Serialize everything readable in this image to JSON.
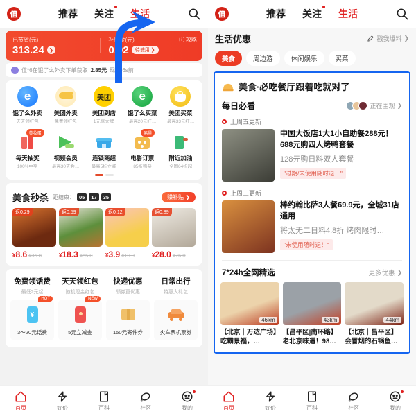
{
  "left": {
    "topbar": {
      "logo_text": "值",
      "tabs": [
        {
          "label": "推荐",
          "active": false,
          "dot": false
        },
        {
          "label": "关注",
          "active": false,
          "dot": true
        },
        {
          "label": "生活",
          "active": true,
          "dot": false
        }
      ],
      "search_icon": "search-icon"
    },
    "banner": {
      "saved_label": "已节省(元)",
      "saved_value": "313.24",
      "subsidy_label": "补贴金(元)",
      "subsidy_value": "0.92",
      "subsidy_pill": "待使用 ❯",
      "guide_label": "攻略",
      "arrow_chevron": "❯"
    },
    "ticker": {
      "prefix": "值*6在饿了么外卖下单获取",
      "amount": "2.85元",
      "suffix": "现金,6s前"
    },
    "grid_row1": [
      {
        "name": "饿了么外卖",
        "sub": "天天领红包",
        "icon": "eleme-icon",
        "color": "#2395ff",
        "tag": ""
      },
      {
        "name": "美团外卖",
        "sub": "免费领红包",
        "icon": "meituan-waimai-icon",
        "color": "#ffd24d",
        "tag": ""
      },
      {
        "name": "美团到店",
        "sub": "1元享大牌",
        "icon": "meituan-icon",
        "color": "#ffcc00",
        "tag": ""
      },
      {
        "name": "饿了么买菜",
        "sub": "最高20元红…",
        "icon": "eleme-green-icon",
        "color": "#27b34a",
        "tag": ""
      },
      {
        "name": "美团买菜",
        "sub": "最高33元红…",
        "icon": "basket-icon",
        "color": "#f5c518",
        "tag": ""
      }
    ],
    "grid_row2": [
      {
        "name": "每天抽奖",
        "sub": "100%中奖",
        "icon": "gift-icon",
        "color": "#f05a5a",
        "tag": "美妆蛋"
      },
      {
        "name": "视频会员",
        "sub": "最高30天会…",
        "icon": "video-play-icon",
        "color": "#5cc85c",
        "tag": ""
      },
      {
        "name": "连锁商超",
        "sub": "最高5折立减",
        "icon": "store-icon",
        "color": "#4db6f0",
        "tag": ""
      },
      {
        "name": "电影订票",
        "sub": "85折购票",
        "icon": "film-icon",
        "color": "#f5b53c",
        "tag": "易量"
      },
      {
        "name": "附近加油",
        "sub": "全国64折起",
        "icon": "fuel-icon",
        "color": "#3cb878",
        "tag": ""
      }
    ],
    "seckill": {
      "title": "美食秒杀",
      "countdown_label": "距结束：",
      "countdown": [
        "05",
        "17",
        "35"
      ],
      "button": "赚补贴 ❯",
      "items": [
        {
          "badge": "返0.29",
          "price": "8.6",
          "old": "¥35.8",
          "thumb": "burger-thumb",
          "c1": "#c0521f",
          "c2": "#7a2d12"
        },
        {
          "badge": "返0.59",
          "price": "18.3",
          "old": "¥55.0",
          "thumb": "skewer-thumb",
          "c1": "#4f8d3a",
          "c2": "#c2782e"
        },
        {
          "badge": "返0.12",
          "price": "3.9",
          "old": "¥10.0",
          "thumb": "dessert-thumb",
          "c1": "#f4c84b",
          "c2": "#f7a9a0"
        },
        {
          "badge": "返0.89",
          "price": "28.0",
          "old": "¥76.0",
          "thumb": "bowl-thumb",
          "c1": "#ddd7cd",
          "c2": "#a8a094"
        }
      ]
    },
    "quad": [
      {
        "title": "免费领话费",
        "sub": "最低2元起",
        "tag": "HOT",
        "label": "3～20元话费",
        "icon": "phone-card-icon",
        "color": "#5bc8f5"
      },
      {
        "title": "天天领红包",
        "sub": "随机现金红包",
        "tag": "NEW",
        "label": "5元立减金",
        "icon": "redpacket-icon",
        "color": "#ef5350"
      },
      {
        "title": "快递优惠",
        "sub": "领券更优惠",
        "tag": "",
        "label": "150元寄件券",
        "icon": "parcel-icon",
        "color": "#f0c069"
      },
      {
        "title": "日常出行",
        "sub": "特惠大礼包",
        "tag": "",
        "label": "火车票机票券",
        "icon": "car-icon",
        "color": "#f08a3c"
      }
    ],
    "tabbar": [
      {
        "label": "首页",
        "icon": "home-icon",
        "active": true,
        "dot": false
      },
      {
        "label": "好价",
        "icon": "tag-icon",
        "active": false,
        "dot": false
      },
      {
        "label": "百科",
        "icon": "book-icon",
        "active": false,
        "dot": false
      },
      {
        "label": "社区",
        "icon": "planet-icon",
        "active": false,
        "dot": false
      },
      {
        "label": "我的",
        "icon": "face-icon",
        "active": false,
        "dot": true
      }
    ]
  },
  "right": {
    "topbar": {
      "logo_text": "值",
      "tabs": [
        {
          "label": "推荐",
          "active": false,
          "dot": false
        },
        {
          "label": "关注",
          "active": false,
          "dot": true
        },
        {
          "label": "生活",
          "active": true,
          "dot": false
        }
      ],
      "search_icon": "search-icon"
    },
    "section": {
      "title": "生活优惠",
      "report_label": "戳我爆料",
      "report_chevron": "❯",
      "pencil_icon": "pencil-icon"
    },
    "chips": [
      {
        "label": "美食",
        "active": true
      },
      {
        "label": "周边游",
        "active": false
      },
      {
        "label": "休闲娱乐",
        "active": false
      },
      {
        "label": "买菜",
        "active": false
      }
    ],
    "highlight": {
      "banner_icon": "food-hat-icon",
      "banner_title": "美食·必吃餐厅跟着吃就对了",
      "daily_title": "每日必看",
      "watching_label": "正在围观",
      "watching_chevron": "❯",
      "avatars": [
        "#8fa7b5",
        "#e8c59a",
        "#6e2a33"
      ],
      "deals": [
        {
          "update": "上周五更新",
          "title": "中国大饭店1大1小自助餐288元！688元购四人烤鸭套餐",
          "sub": "128元购日料双人套餐",
          "note": "\"过期/未使用随时退！\"",
          "thumb": "japanese-food-thumb",
          "c1": "#6d6f63",
          "c2": "#3a3b35"
        },
        {
          "update": "上周三更新",
          "title": "棒约翰比萨3人餐69.9元，全城31店通用",
          "sub": "将太无二日料4.8折 烤肉限时…",
          "note": "\"未使用随时退！\"",
          "thumb": "bbq-food-thumb",
          "c1": "#c8772f",
          "c2": "#7a3321"
        }
      ],
      "picks": {
        "title": "7*24h全网精选",
        "more_label": "更多优惠",
        "more_chevron": "❯",
        "items": [
          {
            "distance": "46km",
            "title": "【北京｜万达广场】吃霸景福，…",
            "c1": "#e8c9a0",
            "c2": "#b5381f"
          },
          {
            "distance": "43km",
            "title": "【昌平区|南环路】老北京味道！98…",
            "c1": "#9aa0a6",
            "c2": "#c23a20"
          },
          {
            "distance": "44km",
            "title": "【北京｜昌平区】会冒烟的石锅鱼…",
            "c1": "#ded6c5",
            "c2": "#7a1f12"
          }
        ]
      }
    },
    "tabbar": [
      {
        "label": "首页",
        "icon": "home-icon",
        "active": true,
        "dot": false
      },
      {
        "label": "好价",
        "icon": "tag-icon",
        "active": false,
        "dot": false
      },
      {
        "label": "百科",
        "icon": "book-icon",
        "active": false,
        "dot": false
      },
      {
        "label": "社区",
        "icon": "planet-icon",
        "active": false,
        "dot": false
      },
      {
        "label": "我的",
        "icon": "face-icon",
        "active": false,
        "dot": true
      }
    ]
  }
}
